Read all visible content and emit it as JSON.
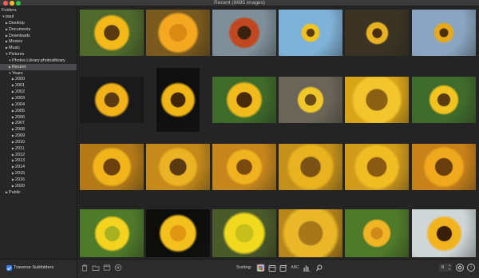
{
  "window": {
    "title": "Recent (8695 images)"
  },
  "sidebar": {
    "header": "Folders",
    "items": [
      {
        "label": "paul",
        "level": 0,
        "tri": "▼",
        "selected": false
      },
      {
        "label": "Desktop",
        "level": 1,
        "tri": "▶",
        "selected": false
      },
      {
        "label": "Documents",
        "level": 1,
        "tri": "▶",
        "selected": false
      },
      {
        "label": "Downloads",
        "level": 1,
        "tri": "▶",
        "selected": false
      },
      {
        "label": "Movies",
        "level": 1,
        "tri": "▶",
        "selected": false
      },
      {
        "label": "Music",
        "level": 1,
        "tri": "▶",
        "selected": false
      },
      {
        "label": "Pictures",
        "level": 1,
        "tri": "▼",
        "selected": false
      },
      {
        "label": "Photos Library.photoslibrary",
        "level": 2,
        "tri": "▼",
        "selected": false
      },
      {
        "label": "Recent",
        "level": 2,
        "tri": "▶",
        "selected": true
      },
      {
        "label": "Years",
        "level": 2,
        "tri": "▼",
        "selected": false
      },
      {
        "label": "2000",
        "level": 3,
        "tri": "▶",
        "selected": false
      },
      {
        "label": "2001",
        "level": 3,
        "tri": "▶",
        "selected": false
      },
      {
        "label": "2002",
        "level": 3,
        "tri": "▶",
        "selected": false
      },
      {
        "label": "2003",
        "level": 3,
        "tri": "▶",
        "selected": false
      },
      {
        "label": "2004",
        "level": 3,
        "tri": "▶",
        "selected": false
      },
      {
        "label": "2005",
        "level": 3,
        "tri": "▶",
        "selected": false
      },
      {
        "label": "2006",
        "level": 3,
        "tri": "▶",
        "selected": false
      },
      {
        "label": "2007",
        "level": 3,
        "tri": "▶",
        "selected": false
      },
      {
        "label": "2008",
        "level": 3,
        "tri": "▶",
        "selected": false
      },
      {
        "label": "2009",
        "level": 3,
        "tri": "▶",
        "selected": false
      },
      {
        "label": "2010",
        "level": 3,
        "tri": "▶",
        "selected": false
      },
      {
        "label": "2011",
        "level": 3,
        "tri": "▶",
        "selected": false
      },
      {
        "label": "2012",
        "level": 3,
        "tri": "▶",
        "selected": false
      },
      {
        "label": "2013",
        "level": 3,
        "tri": "▶",
        "selected": false
      },
      {
        "label": "2014",
        "level": 3,
        "tri": "▶",
        "selected": false
      },
      {
        "label": "2015",
        "level": 3,
        "tri": "▶",
        "selected": false
      },
      {
        "label": "2016",
        "level": 3,
        "tri": "▶",
        "selected": false
      },
      {
        "label": "2020",
        "level": 3,
        "tri": "▶",
        "selected": false
      },
      {
        "label": "Public",
        "level": 1,
        "tri": "▶",
        "selected": false
      }
    ],
    "footer": {
      "checkbox_label": "Traverse Subfolders",
      "checked": true
    }
  },
  "toolbar": {
    "sorting_label": "Sorting:",
    "sort_abc": "ABC",
    "thumb_size": "6",
    "icons": [
      "trash-icon",
      "folder-icon",
      "window-icon",
      "close-circle-icon",
      "calendar-icon",
      "calendar-plus-icon",
      "bar-chart-icon",
      "search-icon",
      "gear-icon",
      "info-icon"
    ]
  },
  "thumbnails": [
    {
      "name": "sunflower-single-green-bg",
      "bg": "#4f6a2c",
      "flower": "#f2b919",
      "center": "#5a3a12",
      "size": 0.8
    },
    {
      "name": "zinnia-orange",
      "bg": "#7a5a1e",
      "flower": "#f4a820",
      "center": "#d88a12",
      "size": 0.9
    },
    {
      "name": "red-sunflower-lake",
      "bg": "#7e8f9a",
      "flower": "#c0471f",
      "center": "#3a2210",
      "size": 0.7
    },
    {
      "name": "sunflower-field-sky",
      "bg": "#7fb2d8",
      "flower": "#f0c21f",
      "center": "#5a3a12",
      "size": 0.4
    },
    {
      "name": "sunflower-sunset",
      "bg": "#3b3424",
      "flower": "#e8b223",
      "center": "#4a2e10",
      "size": 0.5
    },
    {
      "name": "sunflower-field-blue",
      "bg": "#8aa5c2",
      "flower": "#e5a81d",
      "center": "#4a2e10",
      "size": 0.45
    },
    {
      "name": "sunflower-closeup-dark",
      "bg": "#1a1a1a",
      "flower": "#f1b21a",
      "center": "#5a3a12",
      "size": 0.75
    },
    {
      "name": "sunflower-portrait",
      "bg": "#0f0f10",
      "flower": "#f0b516",
      "center": "#3e2508",
      "size": 0.8
    },
    {
      "name": "sunflower-green-leaves",
      "bg": "#3e6a2a",
      "flower": "#f1bb1c",
      "center": "#4a2a0c",
      "size": 0.8
    },
    {
      "name": "sunflower-wall",
      "bg": "#6a6558",
      "flower": "#f0c82a",
      "center": "#6a4a14",
      "size": 0.6
    },
    {
      "name": "sunflower-macro-center",
      "bg": "#d9a518",
      "flower": "#f3c52d",
      "center": "#8a6012",
      "size": 1.1
    },
    {
      "name": "sunflower-side-green",
      "bg": "#3f6b2c",
      "flower": "#f2c321",
      "center": "#5a3a12",
      "size": 0.65
    },
    {
      "name": "sunflower-orange-bg",
      "bg": "#b47a18",
      "flower": "#f1b41b",
      "center": "#6a4010",
      "size": 0.85
    },
    {
      "name": "sunflower-bee",
      "bg": "#c58a1a",
      "flower": "#eab323",
      "center": "#5a3a12",
      "size": 0.85
    },
    {
      "name": "sunflower-blur-orange",
      "bg": "#c6861c",
      "flower": "#f0b21f",
      "center": "#7a4a10",
      "size": 0.8
    },
    {
      "name": "sunflower-seeds-macro",
      "bg": "#c5911b",
      "flower": "#e9b21f",
      "center": "#7a5216",
      "size": 1.05
    },
    {
      "name": "sunflower-seeds-center",
      "bg": "#d19b1b",
      "flower": "#f0bd23",
      "center": "#8a5a12",
      "size": 1.0
    },
    {
      "name": "sunflower-bee-orange",
      "bg": "#c9821a",
      "flower": "#f0a91c",
      "center": "#6a3e0c",
      "size": 0.9
    },
    {
      "name": "yellow-tulips",
      "bg": "#4f7a2a",
      "flower": "#f3d31f",
      "center": "#a8b220",
      "size": 0.75
    },
    {
      "name": "yellow-poppy-dark",
      "bg": "#0d0e0c",
      "flower": "#f4c01e",
      "center": "#e09812",
      "size": 0.8
    },
    {
      "name": "yellow-hibiscus",
      "bg": "#4a5a2a",
      "flower": "#f1d91e",
      "center": "#c8c01a",
      "size": 0.9
    },
    {
      "name": "sunflower-petals-macro",
      "bg": "#b8871a",
      "flower": "#e9b728",
      "center": "#a6781a",
      "size": 1.2
    },
    {
      "name": "zinnia-yellow-green",
      "bg": "#4f7a2a",
      "flower": "#f1b424",
      "center": "#cf8a18",
      "size": 0.6
    },
    {
      "name": "black-eyed-susan",
      "bg": "#cfd6d8",
      "flower": "#f2b41e",
      "center": "#3a200c",
      "size": 0.75
    }
  ]
}
